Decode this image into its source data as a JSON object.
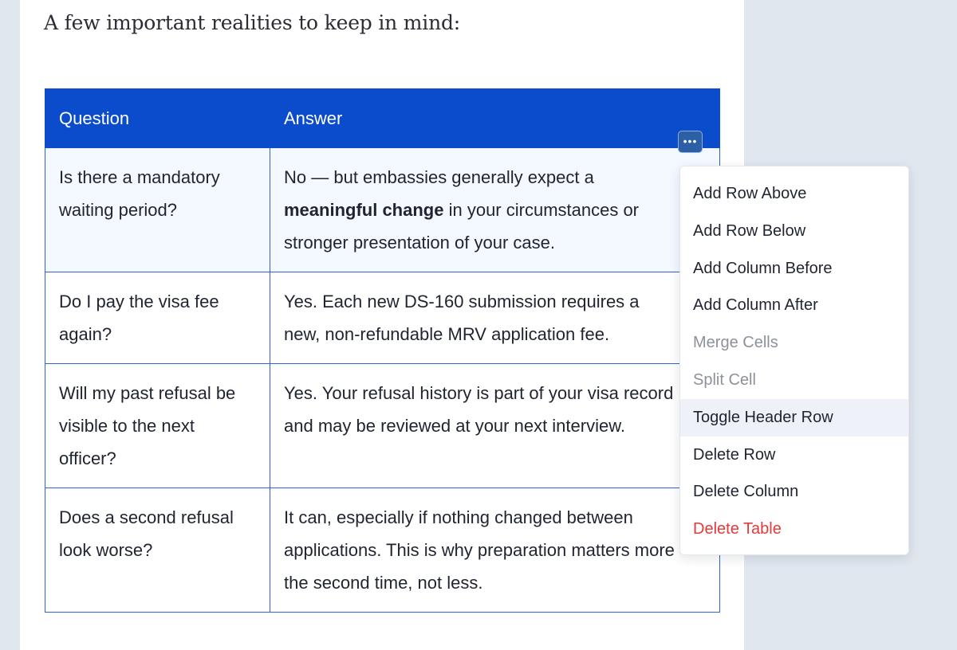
{
  "intro_text": "A few important realities to keep in mind:",
  "table": {
    "headers": [
      "Question",
      "Answer"
    ],
    "rows": [
      {
        "question": "Is there a mandatory waiting period?",
        "answer_pre": "No — but embassies generally expect a ",
        "answer_bold": "meaningful change",
        "answer_post": " in your circumstances or stronger presentation of your case."
      },
      {
        "question": "Do I pay the visa fee again?",
        "answer": "Yes. Each new DS-160 submission requires a new, non-refundable MRV application fee."
      },
      {
        "question": "Will my past refusal be visible to the next officer?",
        "answer": "Yes. Your refusal history is part of your visa record and may be reviewed at your next interview."
      },
      {
        "question": "Does a second refusal look worse?",
        "answer": "It can, especially if nothing changed between applications. This is why preparation matters more the second time, not less."
      }
    ]
  },
  "menu_trigger_icon": "more-horizontal-icon",
  "menu_trigger_glyph": "•••",
  "context_menu": {
    "items": [
      {
        "label": "Add Row Above",
        "state": "normal"
      },
      {
        "label": "Add Row Below",
        "state": "normal"
      },
      {
        "label": "Add Column Before",
        "state": "normal"
      },
      {
        "label": "Add Column After",
        "state": "normal"
      },
      {
        "label": "Merge Cells",
        "state": "disabled"
      },
      {
        "label": "Split Cell",
        "state": "disabled"
      },
      {
        "label": "Toggle Header Row",
        "state": "hover"
      },
      {
        "label": "Delete Row",
        "state": "normal"
      },
      {
        "label": "Delete Column",
        "state": "normal"
      },
      {
        "label": "Delete Table",
        "state": "danger"
      }
    ]
  },
  "colors": {
    "header_bg": "#0a4ccc",
    "table_border": "#2f63cf",
    "danger": "#e23a3a",
    "page_bg": "#e1e7ef"
  }
}
